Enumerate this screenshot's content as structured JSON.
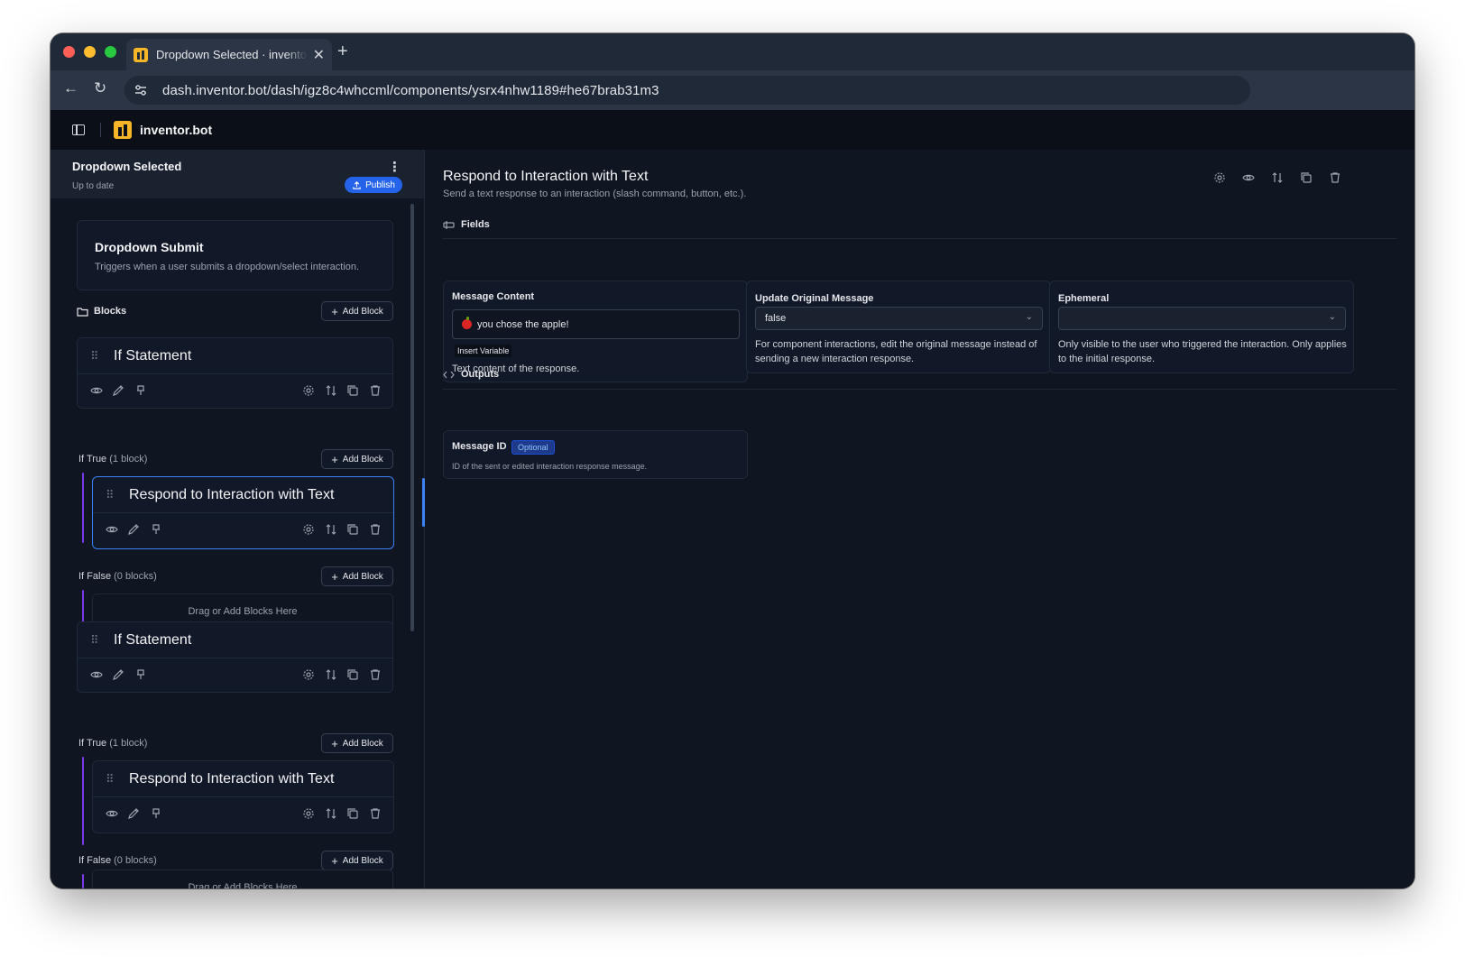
{
  "browser": {
    "tab_title": "Dropdown Selected · inventor.bot",
    "url": "dash.inventor.bot/dash/igz8c4whccml/components/ysrx4nhw1189#he67brab31m3"
  },
  "app": {
    "name": "inventor.bot"
  },
  "sidebar": {
    "title": "Dropdown Selected",
    "status": "Up to date",
    "publish_label": "Publish",
    "trigger": {
      "title": "Dropdown Submit",
      "description": "Triggers when a user submits a dropdown/select interaction."
    },
    "blocks_label": "Blocks",
    "add_block_label": "Add Block",
    "drop_zone_text": "Drag or Add Blocks Here",
    "if_blocks": [
      {
        "title": "If Statement",
        "true_label": "If True",
        "true_count": "(1 block)",
        "true_child": "Respond to Interaction with Text",
        "false_label": "If False",
        "false_count": "(0 blocks)"
      },
      {
        "title": "If Statement",
        "true_label": "If True",
        "true_count": "(1 block)",
        "true_child": "Respond to Interaction with Text",
        "false_label": "If False",
        "false_count": "(0 blocks)"
      }
    ]
  },
  "detail": {
    "title": "Respond to Interaction with Text",
    "subtitle": "Send a text response to an interaction (slash command, button, etc.).",
    "fields_heading": "Fields",
    "outputs_heading": "Outputs",
    "fields": {
      "message_content": {
        "label": "Message Content",
        "value": "you chose the apple!",
        "insert_variable": "Insert Variable",
        "help": "Text content of the response."
      },
      "update_original": {
        "label": "Update Original Message",
        "value": "false",
        "help": "For component interactions, edit the original message instead of sending a new interaction response."
      },
      "ephemeral": {
        "label": "Ephemeral",
        "value": "",
        "help": "Only visible to the user who triggered the interaction. Only applies to the initial response."
      }
    },
    "outputs": {
      "message_id": {
        "label": "Message ID",
        "badge": "Optional",
        "description": "ID of the sent or edited interaction response message."
      }
    }
  },
  "colors": {
    "accent": "#2563eb",
    "selected_border": "#3b82f6",
    "branch_line": "#7c3aed",
    "brand": "#f6b628"
  }
}
